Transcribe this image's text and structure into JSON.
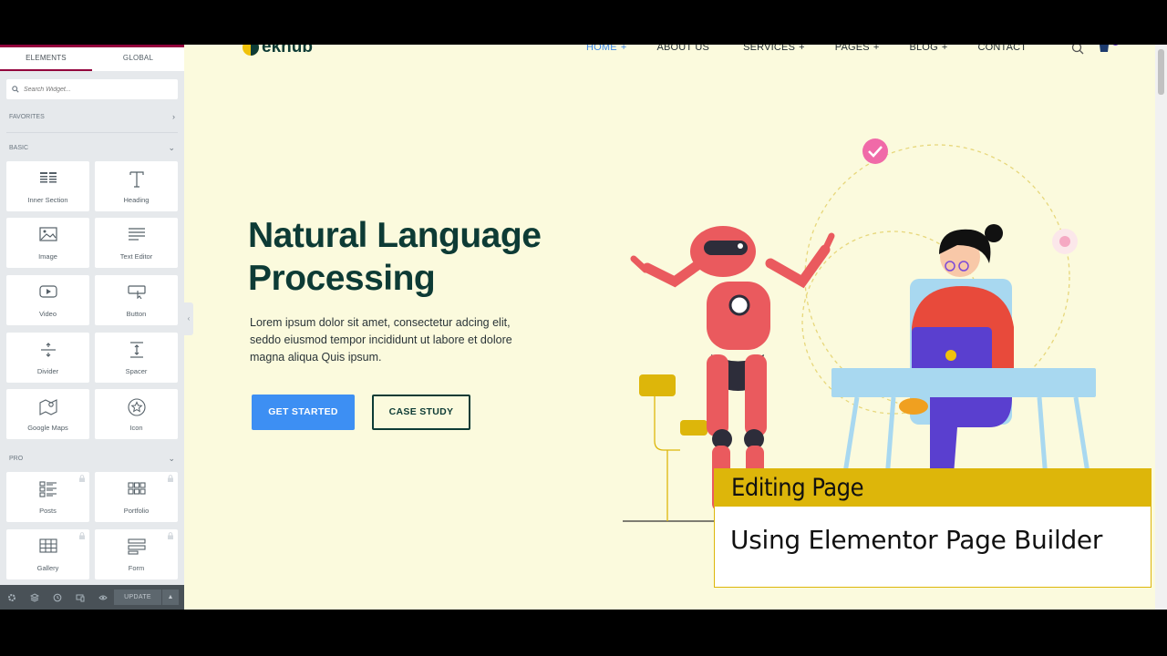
{
  "panel": {
    "tabs": [
      {
        "label": "ELEMENTS",
        "active": true
      },
      {
        "label": "GLOBAL",
        "active": false
      }
    ],
    "search_placeholder": "Search Widget...",
    "categories": {
      "favorites": "FAVORITES",
      "basic": "BASIC",
      "pro": "PRO"
    },
    "basic_widgets": [
      {
        "label": "Inner Section",
        "icon": "inner-section-icon"
      },
      {
        "label": "Heading",
        "icon": "heading-icon"
      },
      {
        "label": "Image",
        "icon": "image-icon"
      },
      {
        "label": "Text Editor",
        "icon": "text-editor-icon"
      },
      {
        "label": "Video",
        "icon": "video-icon"
      },
      {
        "label": "Button",
        "icon": "button-icon"
      },
      {
        "label": "Divider",
        "icon": "divider-icon"
      },
      {
        "label": "Spacer",
        "icon": "spacer-icon"
      },
      {
        "label": "Google Maps",
        "icon": "map-icon"
      },
      {
        "label": "Icon",
        "icon": "star-icon"
      }
    ],
    "pro_widgets": [
      {
        "label": "Posts",
        "icon": "posts-icon"
      },
      {
        "label": "Portfolio",
        "icon": "portfolio-icon"
      },
      {
        "label": "Gallery",
        "icon": "gallery-icon"
      },
      {
        "label": "Form",
        "icon": "form-icon"
      }
    ],
    "footer": {
      "update_label": "UPDATE"
    },
    "accent": "#93003c"
  },
  "site": {
    "logo_text": "eknub",
    "nav": [
      {
        "label": "HOME",
        "plus": "+",
        "active": true
      },
      {
        "label": "ABOUT US",
        "plus": "",
        "active": false
      },
      {
        "label": "SERVICES",
        "plus": "+",
        "active": false
      },
      {
        "label": "PAGES",
        "plus": "+",
        "active": false
      },
      {
        "label": "BLOG",
        "plus": "+",
        "active": false
      },
      {
        "label": "CONTACT",
        "plus": "",
        "active": false
      }
    ],
    "hero": {
      "title_line1": "Natural Language",
      "title_line2": "Processing",
      "text": "Lorem ipsum dolor sit amet, consectetur adcing elit, seddo eiusmod tempor incididunt ut labore et dolore magna aliqua Quis ipsum.",
      "primary_button": "GET STARTED",
      "secondary_button": "CASE STUDY"
    },
    "colors": {
      "background": "#fbfadd",
      "heading": "#0d3b35",
      "primary": "#3d8ff3"
    }
  },
  "overlay": {
    "title": "Editing Page",
    "subtitle": "Using Elementor Page Builder",
    "accent": "#ddb60a"
  }
}
